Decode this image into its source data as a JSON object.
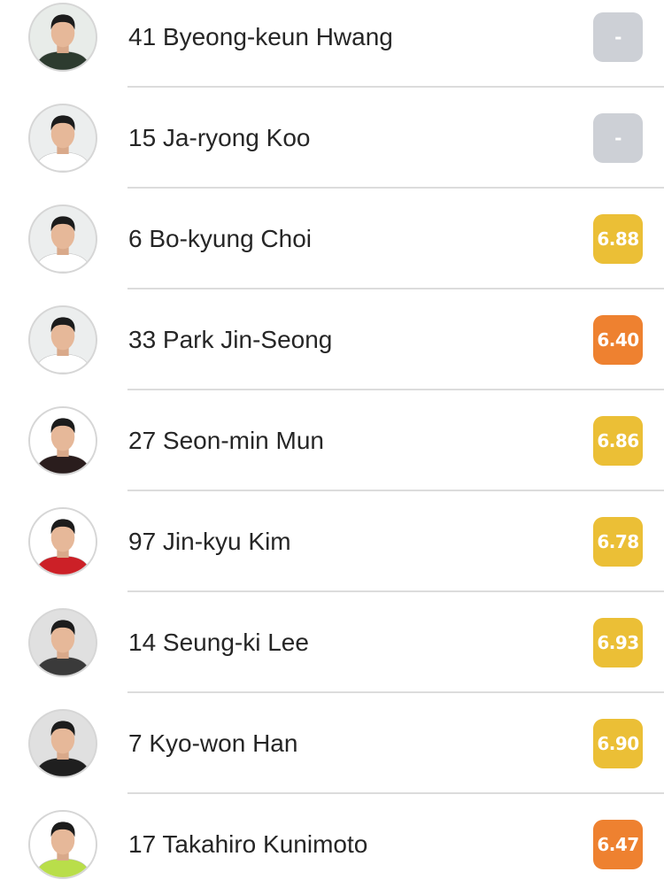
{
  "colors": {
    "rating_none": "#cdd0d6",
    "rating_yellow": "#ebbf36",
    "rating_orange": "#ee8130",
    "divider": "#dcdcdc",
    "text": "#262626"
  },
  "players": [
    {
      "label": "41 Byeong-keun Hwang",
      "rating": "-",
      "rating_color": "#cdd0d6",
      "kit": "#2d3b2f",
      "bg": "#e8ece9"
    },
    {
      "label": "15 Ja-ryong Koo",
      "rating": "-",
      "rating_color": "#cdd0d6",
      "kit": "#ffffff",
      "bg": "#eceeee"
    },
    {
      "label": "6 Bo-kyung Choi",
      "rating": "6.88",
      "rating_color": "#ebbf36",
      "kit": "#ffffff",
      "bg": "#eceeee"
    },
    {
      "label": "33 Park Jin-Seong",
      "rating": "6.40",
      "rating_color": "#ee8130",
      "kit": "#ffffff",
      "bg": "#eceeee"
    },
    {
      "label": "27 Seon-min Mun",
      "rating": "6.86",
      "rating_color": "#ebbf36",
      "kit": "#2a1d1d",
      "bg": "#ffffff"
    },
    {
      "label": "97 Jin-kyu Kim",
      "rating": "6.78",
      "rating_color": "#ebbf36",
      "kit": "#cc2027",
      "bg": "#ffffff"
    },
    {
      "label": "14 Seung-ki Lee",
      "rating": "6.93",
      "rating_color": "#ebbf36",
      "kit": "#3a3a3a",
      "bg": "#e0e0e0"
    },
    {
      "label": "7 Kyo-won Han",
      "rating": "6.90",
      "rating_color": "#ebbf36",
      "kit": "#1f1f1f",
      "bg": "#e0e0e0"
    },
    {
      "label": "17 Takahiro Kunimoto",
      "rating": "6.47",
      "rating_color": "#ee8130",
      "kit": "#b9de4a",
      "bg": "#ffffff"
    }
  ]
}
